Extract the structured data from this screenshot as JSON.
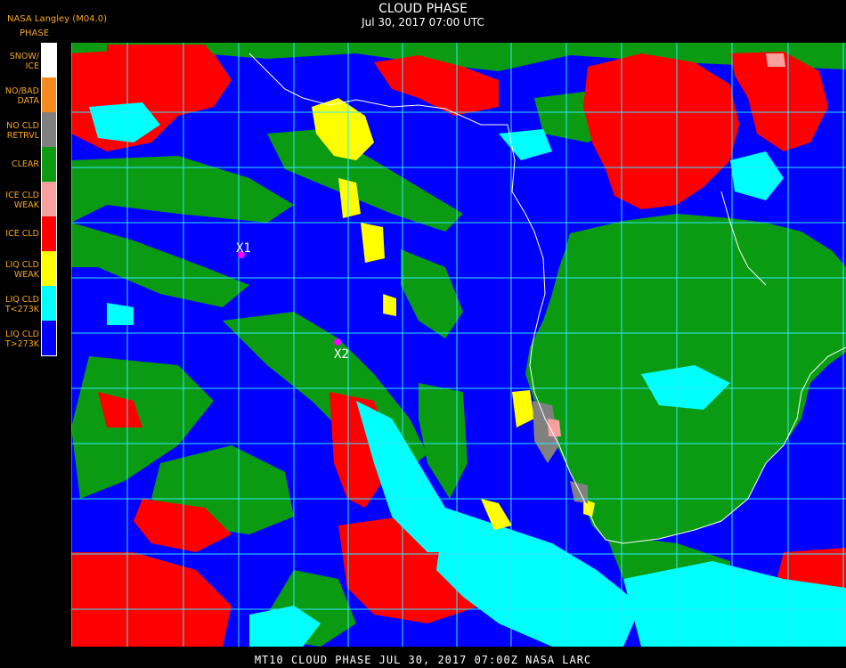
{
  "header": {
    "source": "NASA Langley (M04.0)",
    "param": "PHASE",
    "title": "CLOUD PHASE",
    "subtitle": "Jul 30, 2017 07:00 UTC"
  },
  "legend": [
    {
      "label": "SNOW/\nICE",
      "color": "#ffffff"
    },
    {
      "label": "NO/BAD\nDATA",
      "color": "#f58a1e"
    },
    {
      "label": "NO CLD\nRETRVL",
      "color": "#808080"
    },
    {
      "label": "CLEAR",
      "color": "#0a9b12"
    },
    {
      "label": "ICE CLD\nWEAK",
      "color": "#f6a0a0"
    },
    {
      "label": "ICE CLD",
      "color": "#ff0000"
    },
    {
      "label": "LIQ CLD\nWEAK",
      "color": "#ffff00"
    },
    {
      "label": "LIQ CLD\nT<273K",
      "color": "#00ffff"
    },
    {
      "label": "LIQ CLD\nT>273K",
      "color": "#0000ff"
    }
  ],
  "markers": [
    {
      "label": "X1",
      "color": "#ff00ff"
    },
    {
      "label": "X2",
      "color": "#ff00ff"
    }
  ],
  "colors": {
    "grid": "#30e8ff",
    "coast": "#ffffff",
    "ocean": "#0000ff",
    "land": "#0a9b12",
    "ice": "#ff0000",
    "liq_cold": "#00ffff",
    "liq_weak": "#ffff00"
  },
  "footer": "MT10  CLOUD PHASE   JUL 30, 2017 07:00Z  NASA LARC"
}
